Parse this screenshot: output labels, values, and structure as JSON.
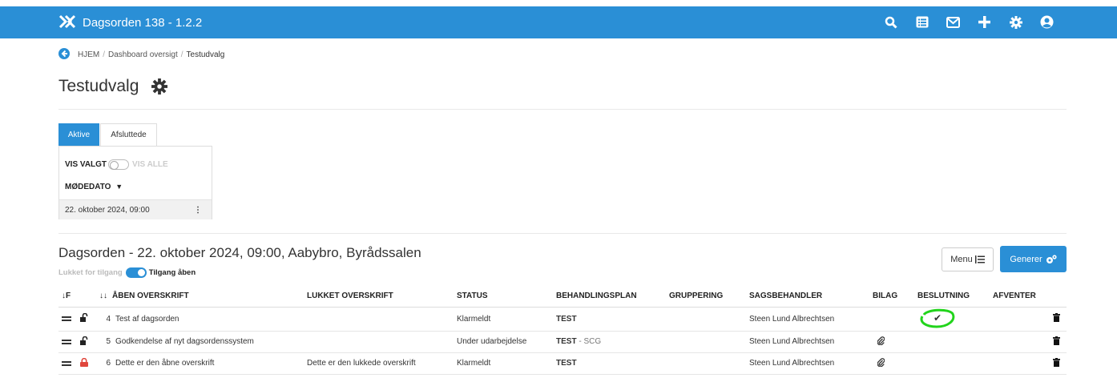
{
  "app": {
    "title": "Dagsorden 138 - 1.2.2",
    "accent": "#2a8fd6"
  },
  "nav_icons": [
    "search-icon",
    "list-icon",
    "mail-icon",
    "plus-icon",
    "gear-icon",
    "user-icon"
  ],
  "breadcrumb": {
    "home": "HJEM",
    "dashboard": "Dashboard oversigt",
    "current": "Testudvalg",
    "sep": "/"
  },
  "page": {
    "title": "Testudvalg"
  },
  "tabs": {
    "active": "Aktive",
    "closed": "Afsluttede"
  },
  "filter": {
    "left": "VIS VALGT",
    "right": "VIS ALLE",
    "sort_label": "MØDEDATO",
    "sort_arrow": "▼"
  },
  "meetings": [
    {
      "date": "22. oktober 2024, 09:00",
      "menu": "⋮"
    }
  ],
  "agenda": {
    "title": "Dagsorden - 22. oktober 2024, 09:00, Aabybro, Byrådssalen",
    "access_off": "Lukket for tilgang",
    "access_on": "Tilgang åben",
    "menu_button": "Menu",
    "generate_button": "Generer"
  },
  "table": {
    "headers": {
      "sort": "↓F",
      "order": "↓↓",
      "open_heading": "ÅBEN OVERSKRIFT",
      "closed_heading": "LUKKET OVERSKRIFT",
      "status": "STATUS",
      "plan": "BEHANDLINGSPLAN",
      "group": "GRUPPERING",
      "handler": "SAGSBEHANDLER",
      "attach": "BILAG",
      "decision": "BESLUTNING",
      "pending": "AFVENTER"
    },
    "rows": [
      {
        "num": "4",
        "lock": "unlocked",
        "open_heading": "Test af dagsorden",
        "closed_heading": "",
        "status": "Klarmeldt",
        "plan": "TEST",
        "plan_extra": "",
        "group": "",
        "handler": "Steen Lund Albrechtsen",
        "attachment": false,
        "decision": "✔"
      },
      {
        "num": "5",
        "lock": "unlocked",
        "open_heading": "Godkendelse af nyt dagsordenssystem",
        "closed_heading": "",
        "status": "Under udarbejdelse",
        "plan": "TEST",
        "plan_extra": " - SCG",
        "group": "",
        "handler": "Steen Lund Albrechtsen",
        "attachment": true,
        "decision": ""
      },
      {
        "num": "6",
        "lock": "locked",
        "open_heading": "Dette er den åbne overskrift",
        "closed_heading": "Dette er den lukkede overskrift",
        "status": "Klarmeldt",
        "plan": "TEST",
        "plan_extra": "",
        "group": "",
        "handler": "Steen Lund Albrechtsen",
        "attachment": true,
        "decision": ""
      }
    ]
  },
  "colors": {
    "lock_locked": "#e0463c",
    "highlight": "#22d41c"
  }
}
